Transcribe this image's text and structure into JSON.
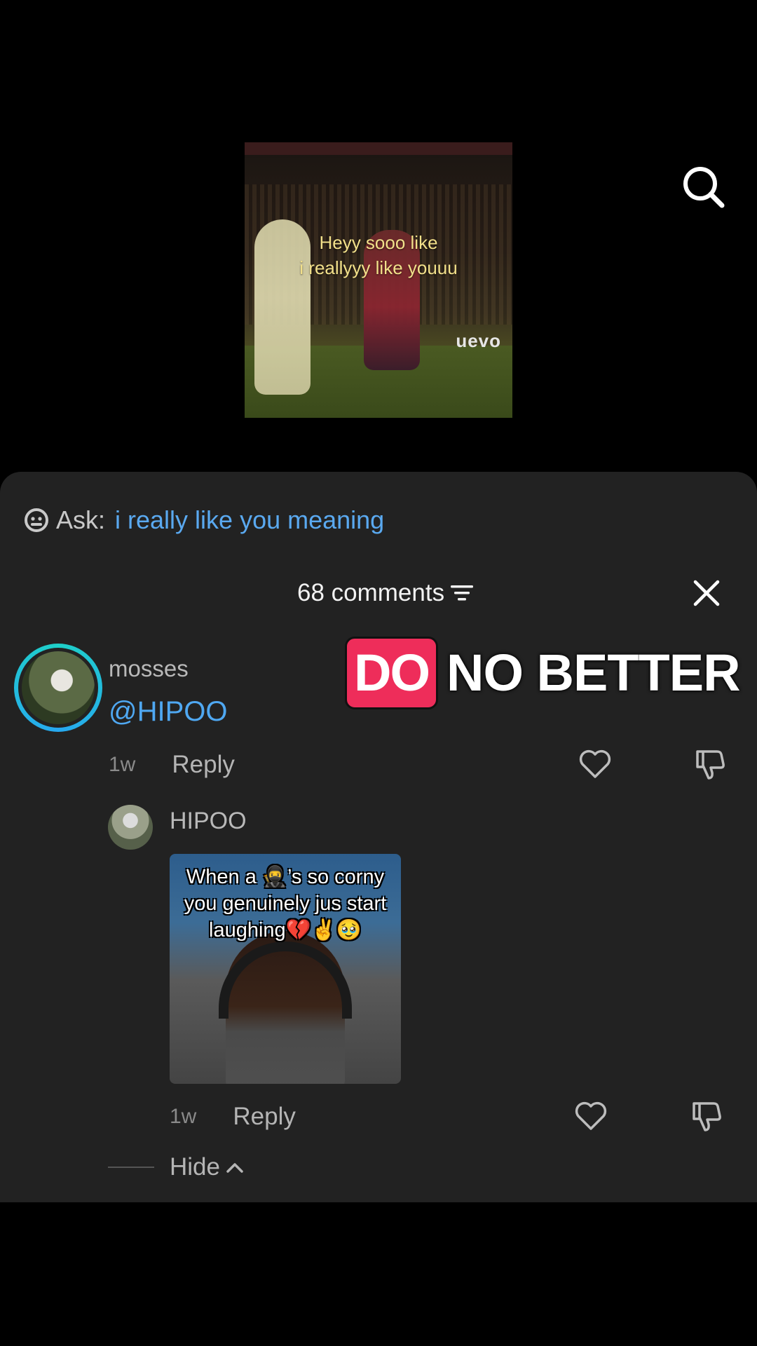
{
  "video": {
    "caption_line1": "Heyy sooo like",
    "caption_line2": "i reallyyy like youuu",
    "banner_text": "uevo"
  },
  "search": {
    "icon": "search-icon"
  },
  "ask": {
    "label": "Ask:",
    "query": "i really like you meaning",
    "query_color": "#5aa9f0"
  },
  "comments_header": {
    "title": "68 comments",
    "filter_icon": "filter-icon",
    "close_icon": "close-icon"
  },
  "comment": {
    "username": "mosses",
    "text": "@HIPOO",
    "time": "1w",
    "reply_label": "Reply",
    "overlay_do": "DO",
    "overlay_rest": "NO BETTER"
  },
  "reply": {
    "username": "HIPOO",
    "image_text": "When a 🥷’s so corny you genuinely jus start laughing💔✌️🥹",
    "time": "1w",
    "reply_label": "Reply"
  },
  "hide": {
    "label": "Hide"
  },
  "colors": {
    "sheet_bg": "#222222",
    "mention_blue": "#4fa8f2",
    "overlay_pink": "#ee2d5a"
  }
}
